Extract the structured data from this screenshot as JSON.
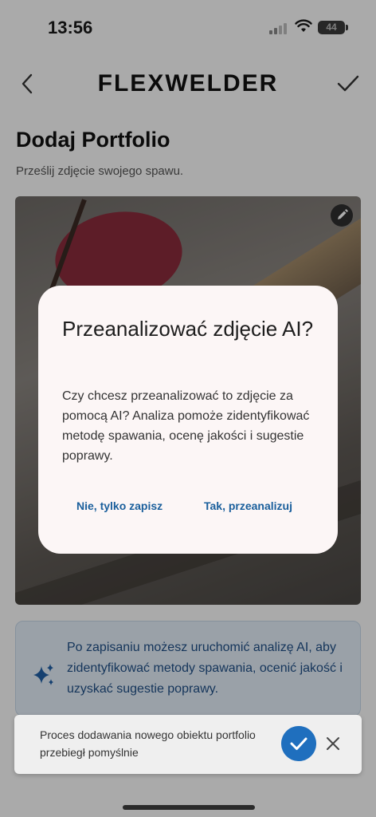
{
  "status_bar": {
    "time": "13:56",
    "battery": "44"
  },
  "header": {
    "logo": "FLEXWELDER"
  },
  "page": {
    "title": "Dodaj Portfolio",
    "subtitle": "Prześlij zdjęcie swojego spawu."
  },
  "info_box": {
    "text": "Po zapisaniu możesz uruchomić analizę AI, aby zidentyfikować metody spawania, ocenić jakość i uzyskać sugestie poprawy."
  },
  "dialog": {
    "title": "Przeanalizować zdjęcie AI?",
    "body": "Czy chcesz przeanalizować to zdjęcie za pomocą AI? Analiza pomoże zidentyfikować metodę spawania, ocenę jakości i sugestie poprawy.",
    "cancel_label": "Nie, tylko zapisz",
    "confirm_label": "Tak, przeanalizuj"
  },
  "snackbar": {
    "message": "Proces dodawania nowego obiektu portfolio przebiegł pomyślnie"
  },
  "colors": {
    "accent": "#1a5f9c",
    "info_bg": "#e4eef8",
    "success": "#1f6fbe"
  },
  "icons": [
    "back-arrow-icon",
    "check-icon",
    "edit-icon",
    "sparkle-icon",
    "close-icon",
    "wifi-icon",
    "signal-icon",
    "battery-icon"
  ]
}
